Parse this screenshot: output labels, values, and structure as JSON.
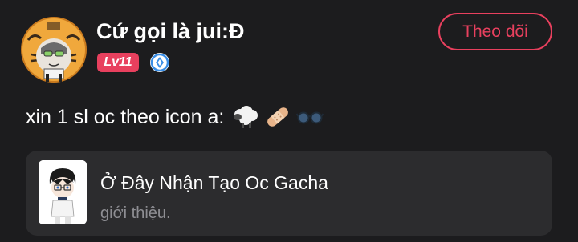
{
  "author": {
    "name": "Cứ gọi là jui:Đ",
    "level_badge": "Lv11",
    "avatar_icon": "tiger-avatar",
    "verified_icon": "verified-badge-icon"
  },
  "follow_button": {
    "label": "Theo dõi"
  },
  "post": {
    "text": "xin 1 sl oc theo icon a:",
    "emojis": [
      "sheep-emoji",
      "bandage-emoji",
      "glasses-emoji"
    ]
  },
  "link_card": {
    "title": "Ở Đây Nhận Tạo Oc Gacha",
    "subtitle": "giới thiệu.",
    "thumbnail_icon": "gacha-character-thumbnail"
  },
  "colors": {
    "background": "#1c1c1e",
    "card_background": "#2c2c2e",
    "accent": "#e8405e",
    "muted_text": "#8e8e93",
    "verified_blue": "#3a8ee6"
  }
}
